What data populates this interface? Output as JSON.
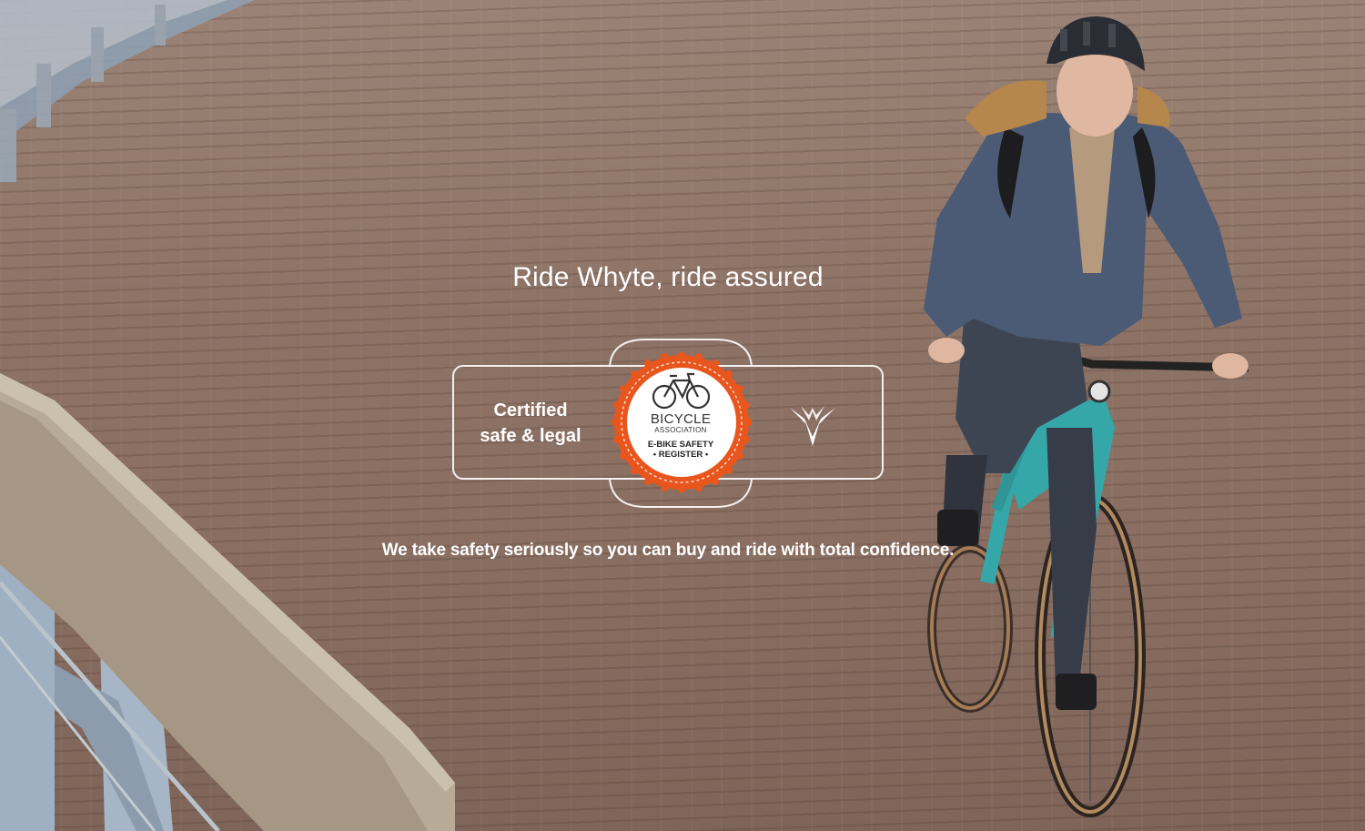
{
  "hero": {
    "headline": "Ride Whyte, ride assured",
    "tagline": "We take safety seriously so you can buy and ride with total confidence."
  },
  "certification": {
    "line1": "Certified",
    "line2": "safe & legal",
    "badge": {
      "title": "BICYCLE",
      "subtitle": "ASSOCIATION",
      "register_line1": "E-BIKE SAFETY",
      "register_line2": "• REGISTER •",
      "accent_color": "#e8561e"
    },
    "brand_mark_icon": "whyte-logo-icon"
  },
  "colors": {
    "text": "#ffffff",
    "deck": "#8d7366",
    "railing": "#a9b4c0",
    "bike": "#35a7a9",
    "jacket": "#4b5a75"
  }
}
